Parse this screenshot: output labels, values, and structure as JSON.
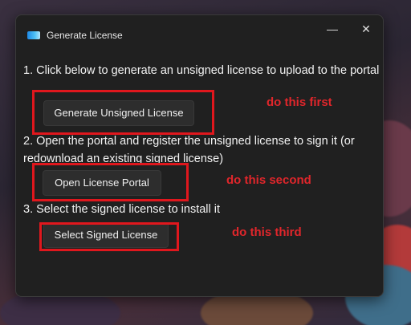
{
  "window": {
    "title": "Generate License",
    "minimize_glyph": "—",
    "close_glyph": "✕"
  },
  "steps": [
    {
      "text": "1. Click below to generate an unsigned license to upload to the portal",
      "button_label": "Generate Unsigned License"
    },
    {
      "text": "2. Open the portal and register the unsigned license to sign it (or redownload an existing signed license)",
      "button_label": "Open License Portal"
    },
    {
      "text": "3. Select the signed license to install it",
      "button_label": "Select Signed License"
    }
  ],
  "annotations": {
    "first": "do this first",
    "second": "do this second",
    "third": "do this third",
    "color": "#e0171d"
  },
  "icons": {
    "app": "app-icon",
    "minimize": "minimize-icon",
    "close": "close-icon"
  }
}
